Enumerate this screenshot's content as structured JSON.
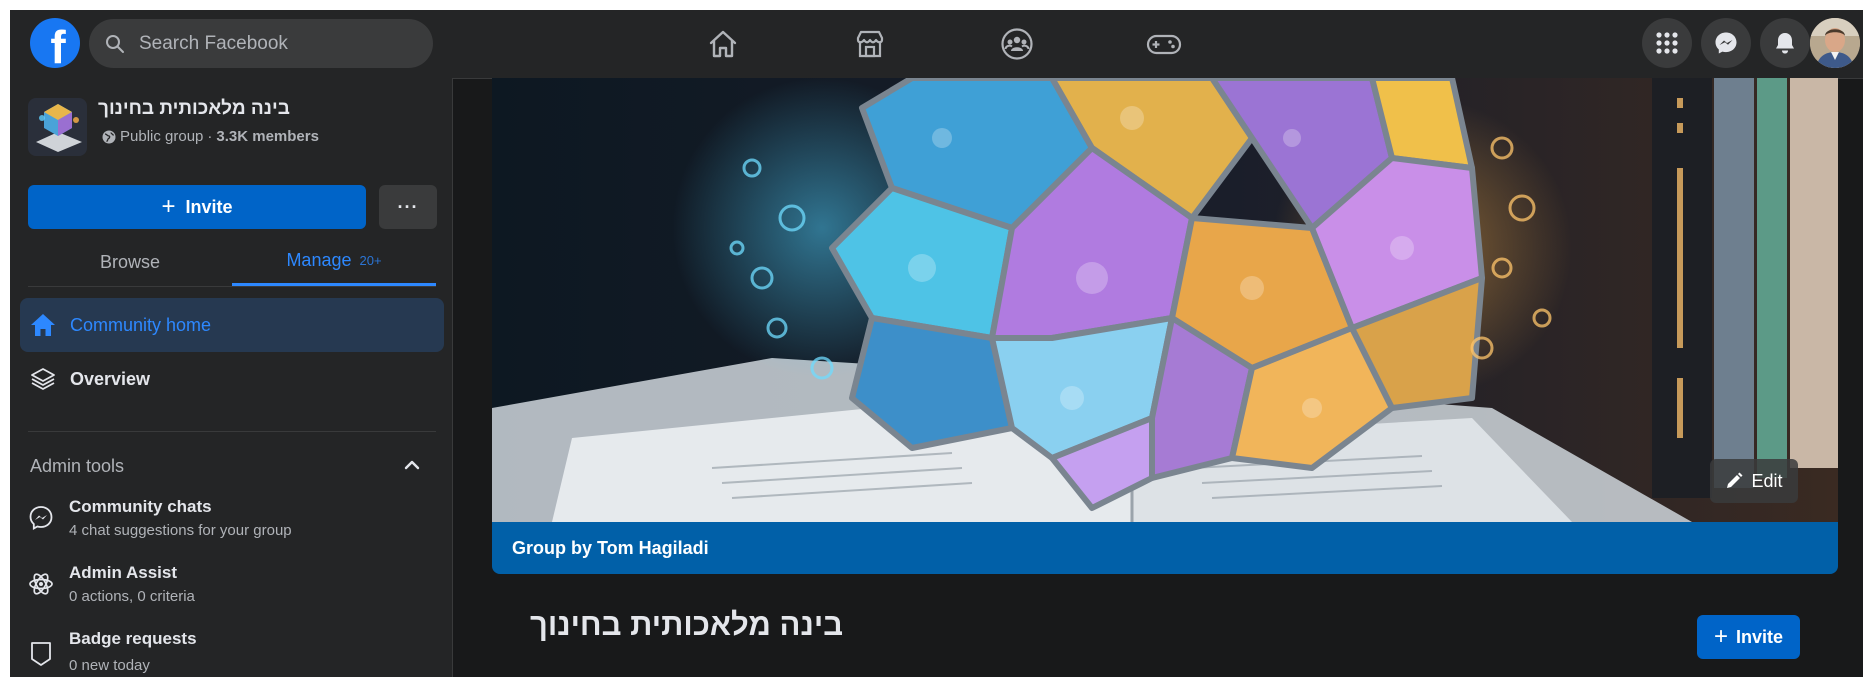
{
  "colors": {
    "facebook_blue": "#1877f2",
    "accent_blue": "#2d88ff",
    "button_blue": "#0064c8",
    "group_bar_blue": "#0160a8",
    "surface_dark": "#242526",
    "background_dark": "#18191a"
  },
  "topbar": {
    "logo_letter": "f",
    "search_placeholder": "Search Facebook",
    "nav_icons": [
      "home-icon",
      "marketplace-icon",
      "groups-icon",
      "gaming-icon"
    ],
    "right_icons": [
      "menu-grid-icon",
      "messenger-icon",
      "notifications-icon",
      "profile-avatar"
    ]
  },
  "sidebar": {
    "group_name": "בינה מלאכותית בחינוך",
    "privacy": "Public group",
    "separator": "·",
    "members": "3.3K members",
    "invite_label": "Invite",
    "more_label": "···",
    "tabs": {
      "browse": "Browse",
      "manage": "Manage",
      "manage_badge": "20+"
    },
    "nav": {
      "community_home": "Community home",
      "overview": "Overview"
    },
    "admin_tools": {
      "title": "Admin tools",
      "items": [
        {
          "title": "Community chats",
          "subtitle": "4 chat suggestions for your group",
          "icon": "messenger-icon"
        },
        {
          "title": "Admin Assist",
          "subtitle": "0 actions, 0 criteria",
          "icon": "atom-icon"
        },
        {
          "title": "Badge requests",
          "subtitle": "0 new today",
          "icon": "badge-icon"
        }
      ]
    }
  },
  "main": {
    "edit_label": "Edit",
    "group_by": "Group by Tom Hagiladi",
    "title": "בינה מלאכותית בחינוך",
    "invite_label": "Invite"
  }
}
